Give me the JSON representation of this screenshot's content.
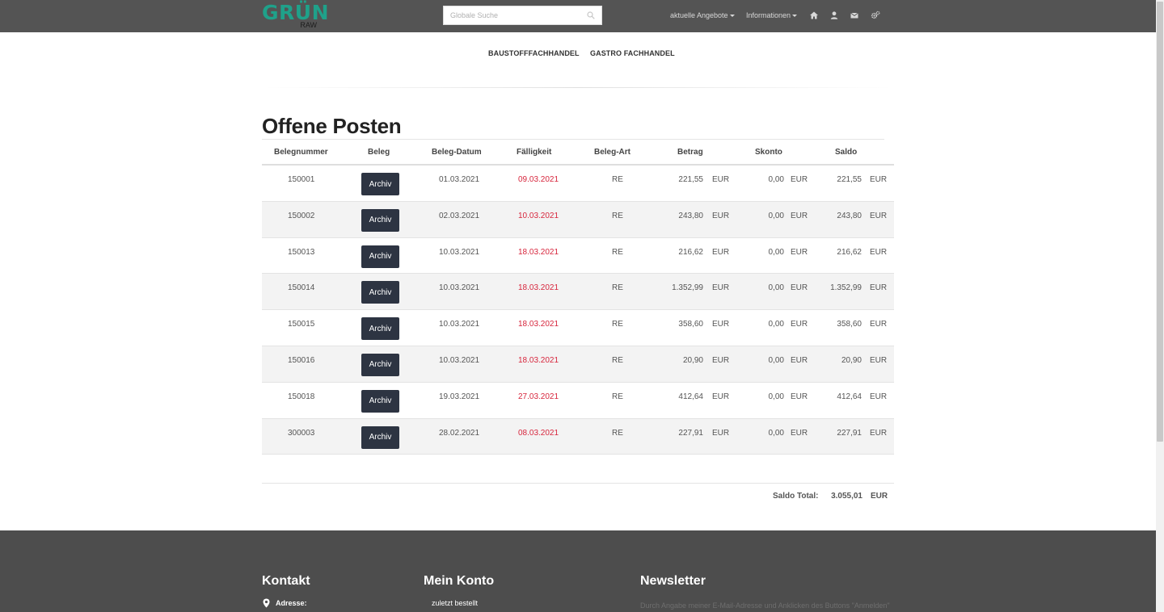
{
  "header": {
    "logo_text": "GRÜN",
    "logo_sub": "RAW",
    "search_placeholder": "Globale Suche",
    "nav": [
      {
        "label": "aktuelle Angebote"
      },
      {
        "label": "Informationen"
      }
    ],
    "icons": [
      "home-icon",
      "user-icon",
      "envelope-icon",
      "cogs-icon"
    ]
  },
  "categories": [
    "BAUSTOFFFACHHANDEL",
    "GASTRO FACHHANDEL"
  ],
  "page": {
    "title": "Offene Posten"
  },
  "table": {
    "columns": [
      "Belegnummer",
      "Beleg",
      "Beleg-Datum",
      "Fälligkeit",
      "Beleg-Art",
      "Betrag",
      "Skonto",
      "Saldo"
    ],
    "rows": [
      {
        "number": "150001",
        "button": "Archiv",
        "date": "01.03.2021",
        "due": "09.03.2021",
        "type": "RE",
        "amount": "221,55",
        "amount_cur": "EUR",
        "skonto": "0,00",
        "skonto_cur": "EUR",
        "saldo": "221,55",
        "saldo_cur": "EUR"
      },
      {
        "number": "150002",
        "button": "Archiv",
        "date": "02.03.2021",
        "due": "10.03.2021",
        "type": "RE",
        "amount": "243,80",
        "amount_cur": "EUR",
        "skonto": "0,00",
        "skonto_cur": "EUR",
        "saldo": "243,80",
        "saldo_cur": "EUR"
      },
      {
        "number": "150013",
        "button": "Archiv",
        "date": "10.03.2021",
        "due": "18.03.2021",
        "type": "RE",
        "amount": "216,62",
        "amount_cur": "EUR",
        "skonto": "0,00",
        "skonto_cur": "EUR",
        "saldo": "216,62",
        "saldo_cur": "EUR"
      },
      {
        "number": "150014",
        "button": "Archiv",
        "date": "10.03.2021",
        "due": "18.03.2021",
        "type": "RE",
        "amount": "1.352,99",
        "amount_cur": "EUR",
        "skonto": "0,00",
        "skonto_cur": "EUR",
        "saldo": "1.352,99",
        "saldo_cur": "EUR"
      },
      {
        "number": "150015",
        "button": "Archiv",
        "date": "10.03.2021",
        "due": "18.03.2021",
        "type": "RE",
        "amount": "358,60",
        "amount_cur": "EUR",
        "skonto": "0,00",
        "skonto_cur": "EUR",
        "saldo": "358,60",
        "saldo_cur": "EUR"
      },
      {
        "number": "150016",
        "button": "Archiv",
        "date": "10.03.2021",
        "due": "18.03.2021",
        "type": "RE",
        "amount": "20,90",
        "amount_cur": "EUR",
        "skonto": "0,00",
        "skonto_cur": "EUR",
        "saldo": "20,90",
        "saldo_cur": "EUR"
      },
      {
        "number": "150018",
        "button": "Archiv",
        "date": "19.03.2021",
        "due": "27.03.2021",
        "type": "RE",
        "amount": "412,64",
        "amount_cur": "EUR",
        "skonto": "0,00",
        "skonto_cur": "EUR",
        "saldo": "412,64",
        "saldo_cur": "EUR"
      },
      {
        "number": "300003",
        "button": "Archiv",
        "date": "28.02.2021",
        "due": "08.03.2021",
        "type": "RE",
        "amount": "227,91",
        "amount_cur": "EUR",
        "skonto": "0,00",
        "skonto_cur": "EUR",
        "saldo": "227,91",
        "saldo_cur": "EUR"
      }
    ],
    "total_label": "Saldo Total:",
    "total_value": "3.055,01",
    "total_cur": "EUR"
  },
  "footer": {
    "kontakt_title": "Kontakt",
    "address_label": "Adresse:",
    "konto_title": "Mein Konto",
    "konto_link": "zuletzt bestellt",
    "newsletter_title": "Newsletter",
    "newsletter_text": "Durch Angabe meiner E-Mail-Adresse und Anklicken des Buttons \"Anmelden\""
  },
  "colors": {
    "topbar": "#545454",
    "logo": "#1fa18a",
    "button": "#2d3442",
    "due": "#d7263d",
    "footer": "#4d4d4d"
  }
}
